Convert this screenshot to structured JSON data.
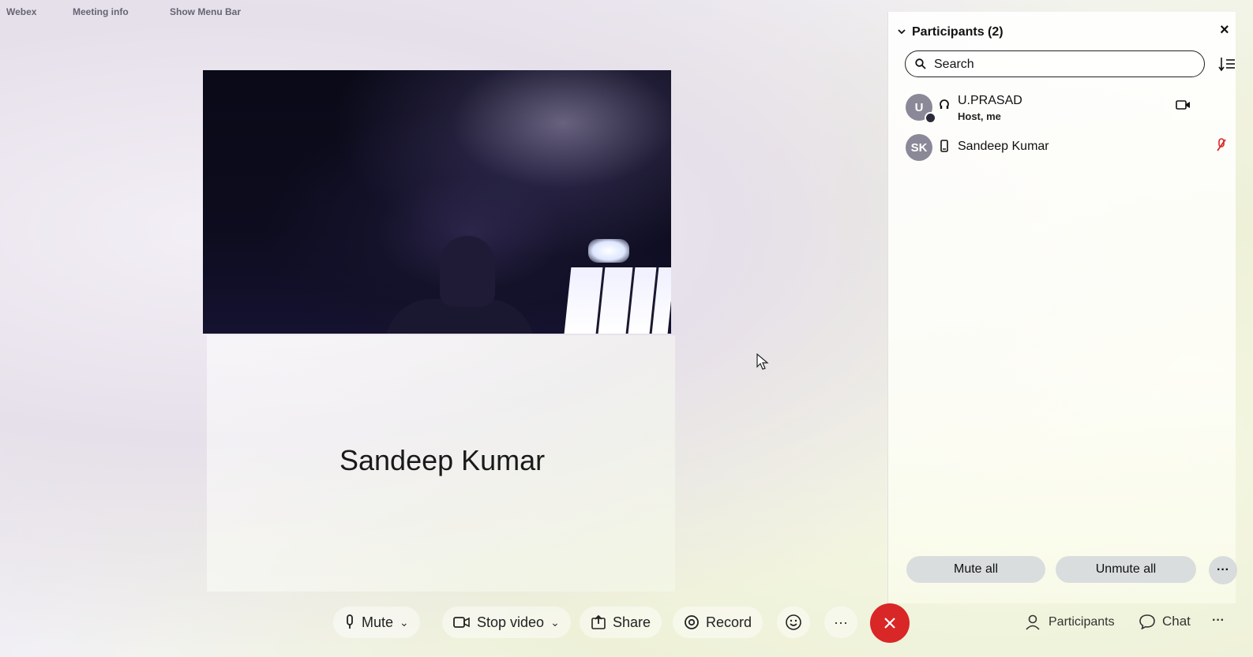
{
  "topbar": {
    "app": "Webex",
    "meeting_info": "Meeting info",
    "show_menu_bar": "Show Menu Bar"
  },
  "stage": {
    "tile_name": "Sandeep Kumar"
  },
  "participants_panel": {
    "title": "Participants (2)",
    "search_placeholder": "Search",
    "participants": [
      {
        "initials": "U",
        "name": "U.PRASAD",
        "role": "Host, me"
      },
      {
        "initials": "SK",
        "name": "Sandeep Kumar",
        "role": ""
      }
    ],
    "mute_all": "Mute all",
    "unmute_all": "Unmute all",
    "more": "···"
  },
  "toolbar": {
    "mute": "Mute",
    "stop_video": "Stop video",
    "share": "Share",
    "record": "Record",
    "more": "···",
    "participants": "Participants",
    "chat": "Chat",
    "overflow": "···"
  },
  "colors": {
    "end_call": "#d92626",
    "avatar": "#8b8897",
    "mute_indicator": "#d92626"
  }
}
